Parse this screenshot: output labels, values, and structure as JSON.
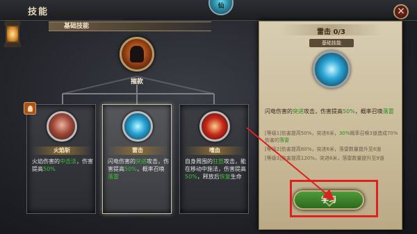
{
  "window": {
    "title": "技能",
    "emblem_label": "仙"
  },
  "close_label": "×",
  "section_title": "基础技能",
  "root_skill": {
    "name": "摧款"
  },
  "skills": [
    {
      "name": "火焰斩",
      "desc": [
        "火焰伤害的",
        "中击法",
        "，",
        "伤害提高",
        "50%"
      ]
    },
    {
      "name": "雷击",
      "desc": [
        "闪电伤害的",
        "突进",
        "攻击，伤害提高",
        "50%",
        "，概率召唤",
        "落雷"
      ]
    },
    {
      "name": "嗜血",
      "desc": [
        "自身周围的",
        "狂怒",
        "攻击，能在移动中施法，伤害提高",
        "50%",
        "，释放后",
        "恢复",
        "生命"
      ]
    }
  ],
  "info_panel": {
    "title": "雷击 0/3",
    "badge": "基础技能",
    "desc": [
      "闪电伤害的",
      "突进",
      "攻击，伤害提高",
      "50%",
      "，概率召唤",
      "落雷"
    ],
    "levels": [
      [
        "[等级1]伤害提高50%，突进6米，",
        "30%",
        "概率召唤3道造成70%伤害的",
        "落雷"
      ],
      [
        "[等级2]伤害提高80%，突进6米，落雷数量提升至6道"
      ],
      [
        "[等级3]伤害提高120%，突进6米，落雷数量提升至9道"
      ]
    ]
  },
  "learn_button": "学习",
  "colors": {
    "highlight_green": "#3fbf3a",
    "annotation_red": "#e01f1f",
    "parchment": "#d8cdb2"
  }
}
